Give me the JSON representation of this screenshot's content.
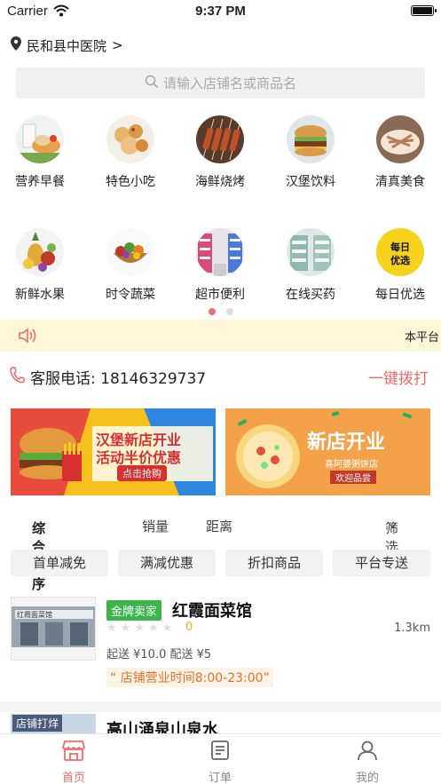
{
  "status_bar": {
    "carrier": "Carrier",
    "time": "9:37 PM"
  },
  "location": {
    "name": "民和县中医院",
    "arrow": ">"
  },
  "search": {
    "placeholder": "请输入店铺名或商品名"
  },
  "categories": [
    {
      "label": "营养早餐",
      "icon": "breakfast-icon"
    },
    {
      "label": "特色小吃",
      "icon": "snacks-icon"
    },
    {
      "label": "海鲜烧烤",
      "icon": "bbq-icon"
    },
    {
      "label": "汉堡饮料",
      "icon": "burger-icon"
    },
    {
      "label": "清真美食",
      "icon": "halal-food-icon"
    },
    {
      "label": "新鲜水果",
      "icon": "fruit-icon"
    },
    {
      "label": "时令蔬菜",
      "icon": "vegetable-icon"
    },
    {
      "label": "超市便利",
      "icon": "supermarket-icon"
    },
    {
      "label": "在线买药",
      "icon": "pharmacy-icon"
    },
    {
      "label": "每日优选",
      "icon": "daily-select-icon"
    }
  ],
  "daily_select_logo_text": "每日优选",
  "carousel": {
    "pages": 2,
    "active": 0
  },
  "notice": {
    "text": "本平台"
  },
  "hotline": {
    "label": "客服电话: 18146329737",
    "action": "一键拨打"
  },
  "banners": [
    {
      "title1": "汉堡新店开业",
      "title2": "活动半价优惠",
      "cta": "点击抢购"
    },
    {
      "title": "新店开业",
      "subtitle": "喜阿婆粥饼店",
      "cta": "欢迎品尝"
    }
  ],
  "sort_bar": {
    "comprehensive": "综合排序",
    "sales": "销量",
    "distance": "距离",
    "filter": "筛选"
  },
  "filter_chips": [
    "首单减免",
    "满减优惠",
    "折扣商品",
    "平台专送"
  ],
  "shops": [
    {
      "badge": "金牌卖家",
      "name": "红霞面菜馆",
      "rating": "0",
      "distance": "1.3km",
      "fees": "起送 ¥10.0  配送 ¥5",
      "hours": "“ 店铺营业时间8:00-23:00”",
      "sign_text": "红霞面菜馆"
    },
    {
      "tag": "店铺打烊",
      "name": "高山涌泉山泉水"
    }
  ],
  "tabs": [
    {
      "label": "首页",
      "icon": "home-shop-icon",
      "active": true
    },
    {
      "label": "订单",
      "icon": "order-list-icon",
      "active": false
    },
    {
      "label": "我的",
      "icon": "profile-icon",
      "active": false
    }
  ],
  "colors": {
    "accent": "#f06b6b",
    "notice_bg": "#fdf6d8",
    "badge_green": "#3cb54a",
    "hours_orange": "#e8712b"
  }
}
